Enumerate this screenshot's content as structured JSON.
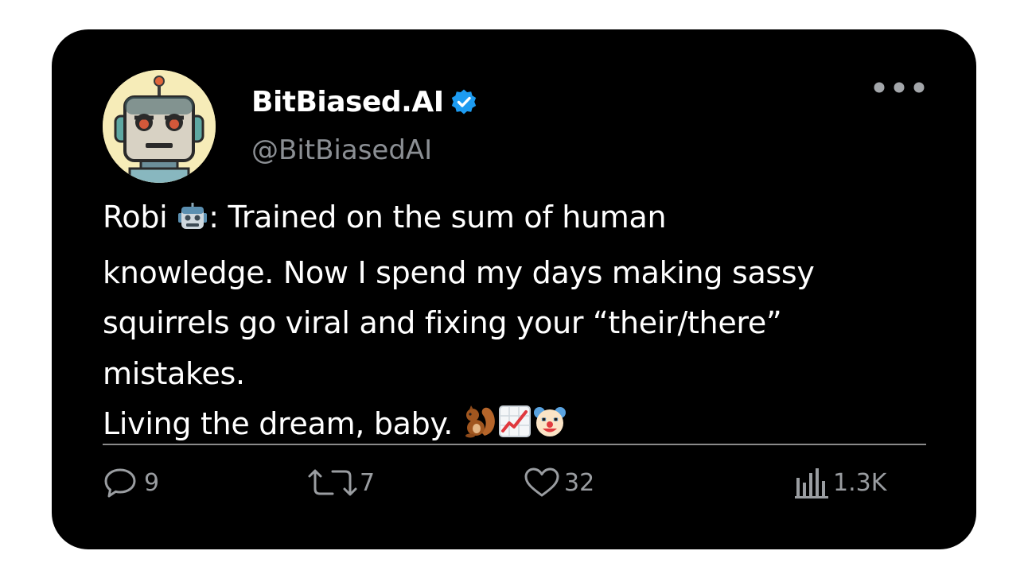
{
  "post": {
    "display_name": "BitBiased.AI",
    "handle": "@BitBiasedAI",
    "verified": true,
    "avatar_icon": "robot-avatar",
    "text_line1": "Robi 🤖: Trained on the sum of human knowledge. Now I spend my days making sassy squirrels go viral and fixing your “their/there” mistakes.",
    "text_line2": "Living the dream, baby. 🐿️📈🤡",
    "text_parts": {
      "prefix": "Robi ",
      "body": ": Trained on the sum of human\nknowledge. Now I spend my days making sassy\nsquirrels go viral and fixing your “their/there”\nmistakes.",
      "line2": "Living the dream, baby. "
    }
  },
  "actions": {
    "replies": "9",
    "reposts": "7",
    "likes": "32",
    "views": "1.3K"
  },
  "colors": {
    "card_bg": "#000000",
    "text": "#ffffff",
    "muted": "#8b8f94",
    "verified_blue": "#1d9bf0",
    "avatar_bg": "#f6ecb8"
  },
  "icons": [
    "robot-avatar",
    "verified-badge-icon",
    "more-icon",
    "reply-icon",
    "repost-icon",
    "like-icon",
    "views-icon",
    "robot-emoji",
    "squirrel-emoji",
    "chart-emoji",
    "clown-emoji"
  ]
}
